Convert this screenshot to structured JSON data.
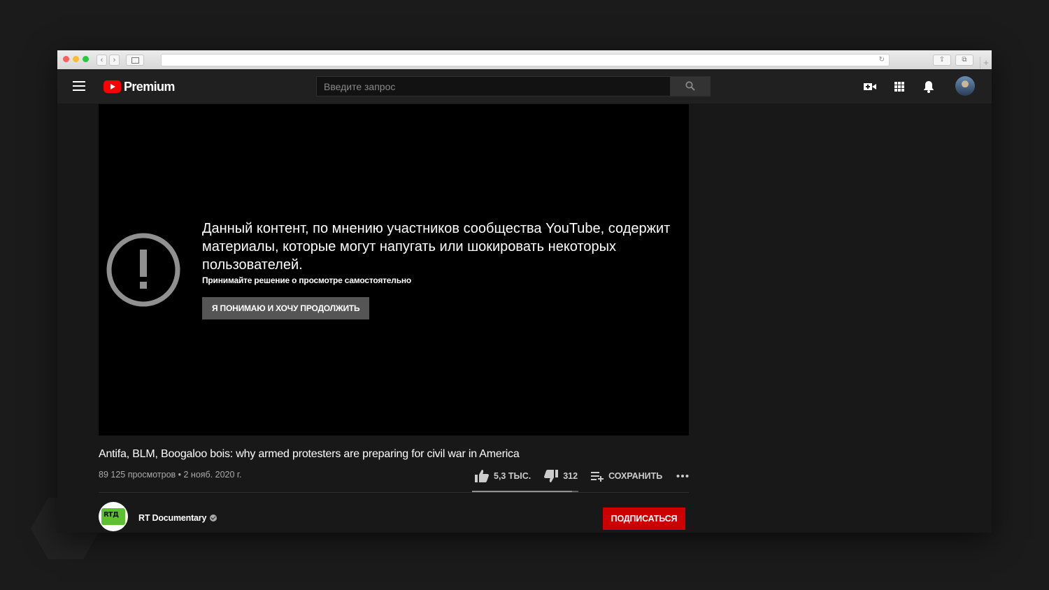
{
  "header": {
    "logo_text": "Premium",
    "search_placeholder": "Введите запрос"
  },
  "player": {
    "warning_title": "Данный контент, по мнению участников сообщества YouTube, содержит материалы, которые могут напугать или шокировать некоторых пользователей.",
    "warning_subtitle": "Принимайте решение о просмотре самостоятельно",
    "continue_label": "Я ПОНИМАЮ И ХОЧУ ПРОДОЛЖИТЬ"
  },
  "video": {
    "title": "Antifa, BLM, Boogaloo bois: why armed protesters are preparing for civil war in America",
    "meta": "89 125 просмотров • 2 нояб. 2020 г.",
    "likes": "5,3 ТЫС.",
    "dislikes": "312",
    "save_label": "СОХРАНИТЬ",
    "like_ratio": 0.94
  },
  "channel": {
    "name": "RT Documentary",
    "avatar_text": "RTД",
    "subscribe_label": "ПОДПИСАТЬСЯ"
  },
  "colors": {
    "brand_red": "#ff0000",
    "subscribe_red": "#cc0000",
    "background": "#181818"
  },
  "icons": [
    "menu-icon",
    "youtube-logo-icon",
    "search-icon",
    "create-video-icon",
    "apps-icon",
    "bell-icon",
    "warning-icon",
    "thumb-up-icon",
    "thumb-down-icon",
    "playlist-add-icon",
    "more-icon",
    "verified-icon"
  ]
}
